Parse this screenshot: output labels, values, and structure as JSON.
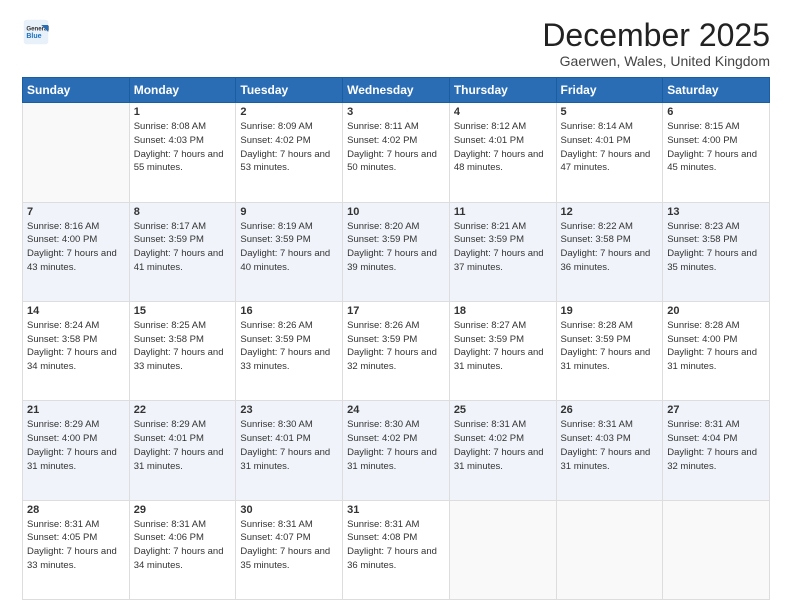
{
  "logo": {
    "general": "General",
    "blue": "Blue"
  },
  "header": {
    "month": "December 2025",
    "location": "Gaerwen, Wales, United Kingdom"
  },
  "weekdays": [
    "Sunday",
    "Monday",
    "Tuesday",
    "Wednesday",
    "Thursday",
    "Friday",
    "Saturday"
  ],
  "weeks": [
    [
      {
        "day": "",
        "sunrise": "",
        "sunset": "",
        "daylight": ""
      },
      {
        "day": "1",
        "sunrise": "Sunrise: 8:08 AM",
        "sunset": "Sunset: 4:03 PM",
        "daylight": "Daylight: 7 hours and 55 minutes."
      },
      {
        "day": "2",
        "sunrise": "Sunrise: 8:09 AM",
        "sunset": "Sunset: 4:02 PM",
        "daylight": "Daylight: 7 hours and 53 minutes."
      },
      {
        "day": "3",
        "sunrise": "Sunrise: 8:11 AM",
        "sunset": "Sunset: 4:02 PM",
        "daylight": "Daylight: 7 hours and 50 minutes."
      },
      {
        "day": "4",
        "sunrise": "Sunrise: 8:12 AM",
        "sunset": "Sunset: 4:01 PM",
        "daylight": "Daylight: 7 hours and 48 minutes."
      },
      {
        "day": "5",
        "sunrise": "Sunrise: 8:14 AM",
        "sunset": "Sunset: 4:01 PM",
        "daylight": "Daylight: 7 hours and 47 minutes."
      },
      {
        "day": "6",
        "sunrise": "Sunrise: 8:15 AM",
        "sunset": "Sunset: 4:00 PM",
        "daylight": "Daylight: 7 hours and 45 minutes."
      }
    ],
    [
      {
        "day": "7",
        "sunrise": "Sunrise: 8:16 AM",
        "sunset": "Sunset: 4:00 PM",
        "daylight": "Daylight: 7 hours and 43 minutes."
      },
      {
        "day": "8",
        "sunrise": "Sunrise: 8:17 AM",
        "sunset": "Sunset: 3:59 PM",
        "daylight": "Daylight: 7 hours and 41 minutes."
      },
      {
        "day": "9",
        "sunrise": "Sunrise: 8:19 AM",
        "sunset": "Sunset: 3:59 PM",
        "daylight": "Daylight: 7 hours and 40 minutes."
      },
      {
        "day": "10",
        "sunrise": "Sunrise: 8:20 AM",
        "sunset": "Sunset: 3:59 PM",
        "daylight": "Daylight: 7 hours and 39 minutes."
      },
      {
        "day": "11",
        "sunrise": "Sunrise: 8:21 AM",
        "sunset": "Sunset: 3:59 PM",
        "daylight": "Daylight: 7 hours and 37 minutes."
      },
      {
        "day": "12",
        "sunrise": "Sunrise: 8:22 AM",
        "sunset": "Sunset: 3:58 PM",
        "daylight": "Daylight: 7 hours and 36 minutes."
      },
      {
        "day": "13",
        "sunrise": "Sunrise: 8:23 AM",
        "sunset": "Sunset: 3:58 PM",
        "daylight": "Daylight: 7 hours and 35 minutes."
      }
    ],
    [
      {
        "day": "14",
        "sunrise": "Sunrise: 8:24 AM",
        "sunset": "Sunset: 3:58 PM",
        "daylight": "Daylight: 7 hours and 34 minutes."
      },
      {
        "day": "15",
        "sunrise": "Sunrise: 8:25 AM",
        "sunset": "Sunset: 3:58 PM",
        "daylight": "Daylight: 7 hours and 33 minutes."
      },
      {
        "day": "16",
        "sunrise": "Sunrise: 8:26 AM",
        "sunset": "Sunset: 3:59 PM",
        "daylight": "Daylight: 7 hours and 33 minutes."
      },
      {
        "day": "17",
        "sunrise": "Sunrise: 8:26 AM",
        "sunset": "Sunset: 3:59 PM",
        "daylight": "Daylight: 7 hours and 32 minutes."
      },
      {
        "day": "18",
        "sunrise": "Sunrise: 8:27 AM",
        "sunset": "Sunset: 3:59 PM",
        "daylight": "Daylight: 7 hours and 31 minutes."
      },
      {
        "day": "19",
        "sunrise": "Sunrise: 8:28 AM",
        "sunset": "Sunset: 3:59 PM",
        "daylight": "Daylight: 7 hours and 31 minutes."
      },
      {
        "day": "20",
        "sunrise": "Sunrise: 8:28 AM",
        "sunset": "Sunset: 4:00 PM",
        "daylight": "Daylight: 7 hours and 31 minutes."
      }
    ],
    [
      {
        "day": "21",
        "sunrise": "Sunrise: 8:29 AM",
        "sunset": "Sunset: 4:00 PM",
        "daylight": "Daylight: 7 hours and 31 minutes."
      },
      {
        "day": "22",
        "sunrise": "Sunrise: 8:29 AM",
        "sunset": "Sunset: 4:01 PM",
        "daylight": "Daylight: 7 hours and 31 minutes."
      },
      {
        "day": "23",
        "sunrise": "Sunrise: 8:30 AM",
        "sunset": "Sunset: 4:01 PM",
        "daylight": "Daylight: 7 hours and 31 minutes."
      },
      {
        "day": "24",
        "sunrise": "Sunrise: 8:30 AM",
        "sunset": "Sunset: 4:02 PM",
        "daylight": "Daylight: 7 hours and 31 minutes."
      },
      {
        "day": "25",
        "sunrise": "Sunrise: 8:31 AM",
        "sunset": "Sunset: 4:02 PM",
        "daylight": "Daylight: 7 hours and 31 minutes."
      },
      {
        "day": "26",
        "sunrise": "Sunrise: 8:31 AM",
        "sunset": "Sunset: 4:03 PM",
        "daylight": "Daylight: 7 hours and 31 minutes."
      },
      {
        "day": "27",
        "sunrise": "Sunrise: 8:31 AM",
        "sunset": "Sunset: 4:04 PM",
        "daylight": "Daylight: 7 hours and 32 minutes."
      }
    ],
    [
      {
        "day": "28",
        "sunrise": "Sunrise: 8:31 AM",
        "sunset": "Sunset: 4:05 PM",
        "daylight": "Daylight: 7 hours and 33 minutes."
      },
      {
        "day": "29",
        "sunrise": "Sunrise: 8:31 AM",
        "sunset": "Sunset: 4:06 PM",
        "daylight": "Daylight: 7 hours and 34 minutes."
      },
      {
        "day": "30",
        "sunrise": "Sunrise: 8:31 AM",
        "sunset": "Sunset: 4:07 PM",
        "daylight": "Daylight: 7 hours and 35 minutes."
      },
      {
        "day": "31",
        "sunrise": "Sunrise: 8:31 AM",
        "sunset": "Sunset: 4:08 PM",
        "daylight": "Daylight: 7 hours and 36 minutes."
      },
      {
        "day": "",
        "sunrise": "",
        "sunset": "",
        "daylight": ""
      },
      {
        "day": "",
        "sunrise": "",
        "sunset": "",
        "daylight": ""
      },
      {
        "day": "",
        "sunrise": "",
        "sunset": "",
        "daylight": ""
      }
    ]
  ]
}
